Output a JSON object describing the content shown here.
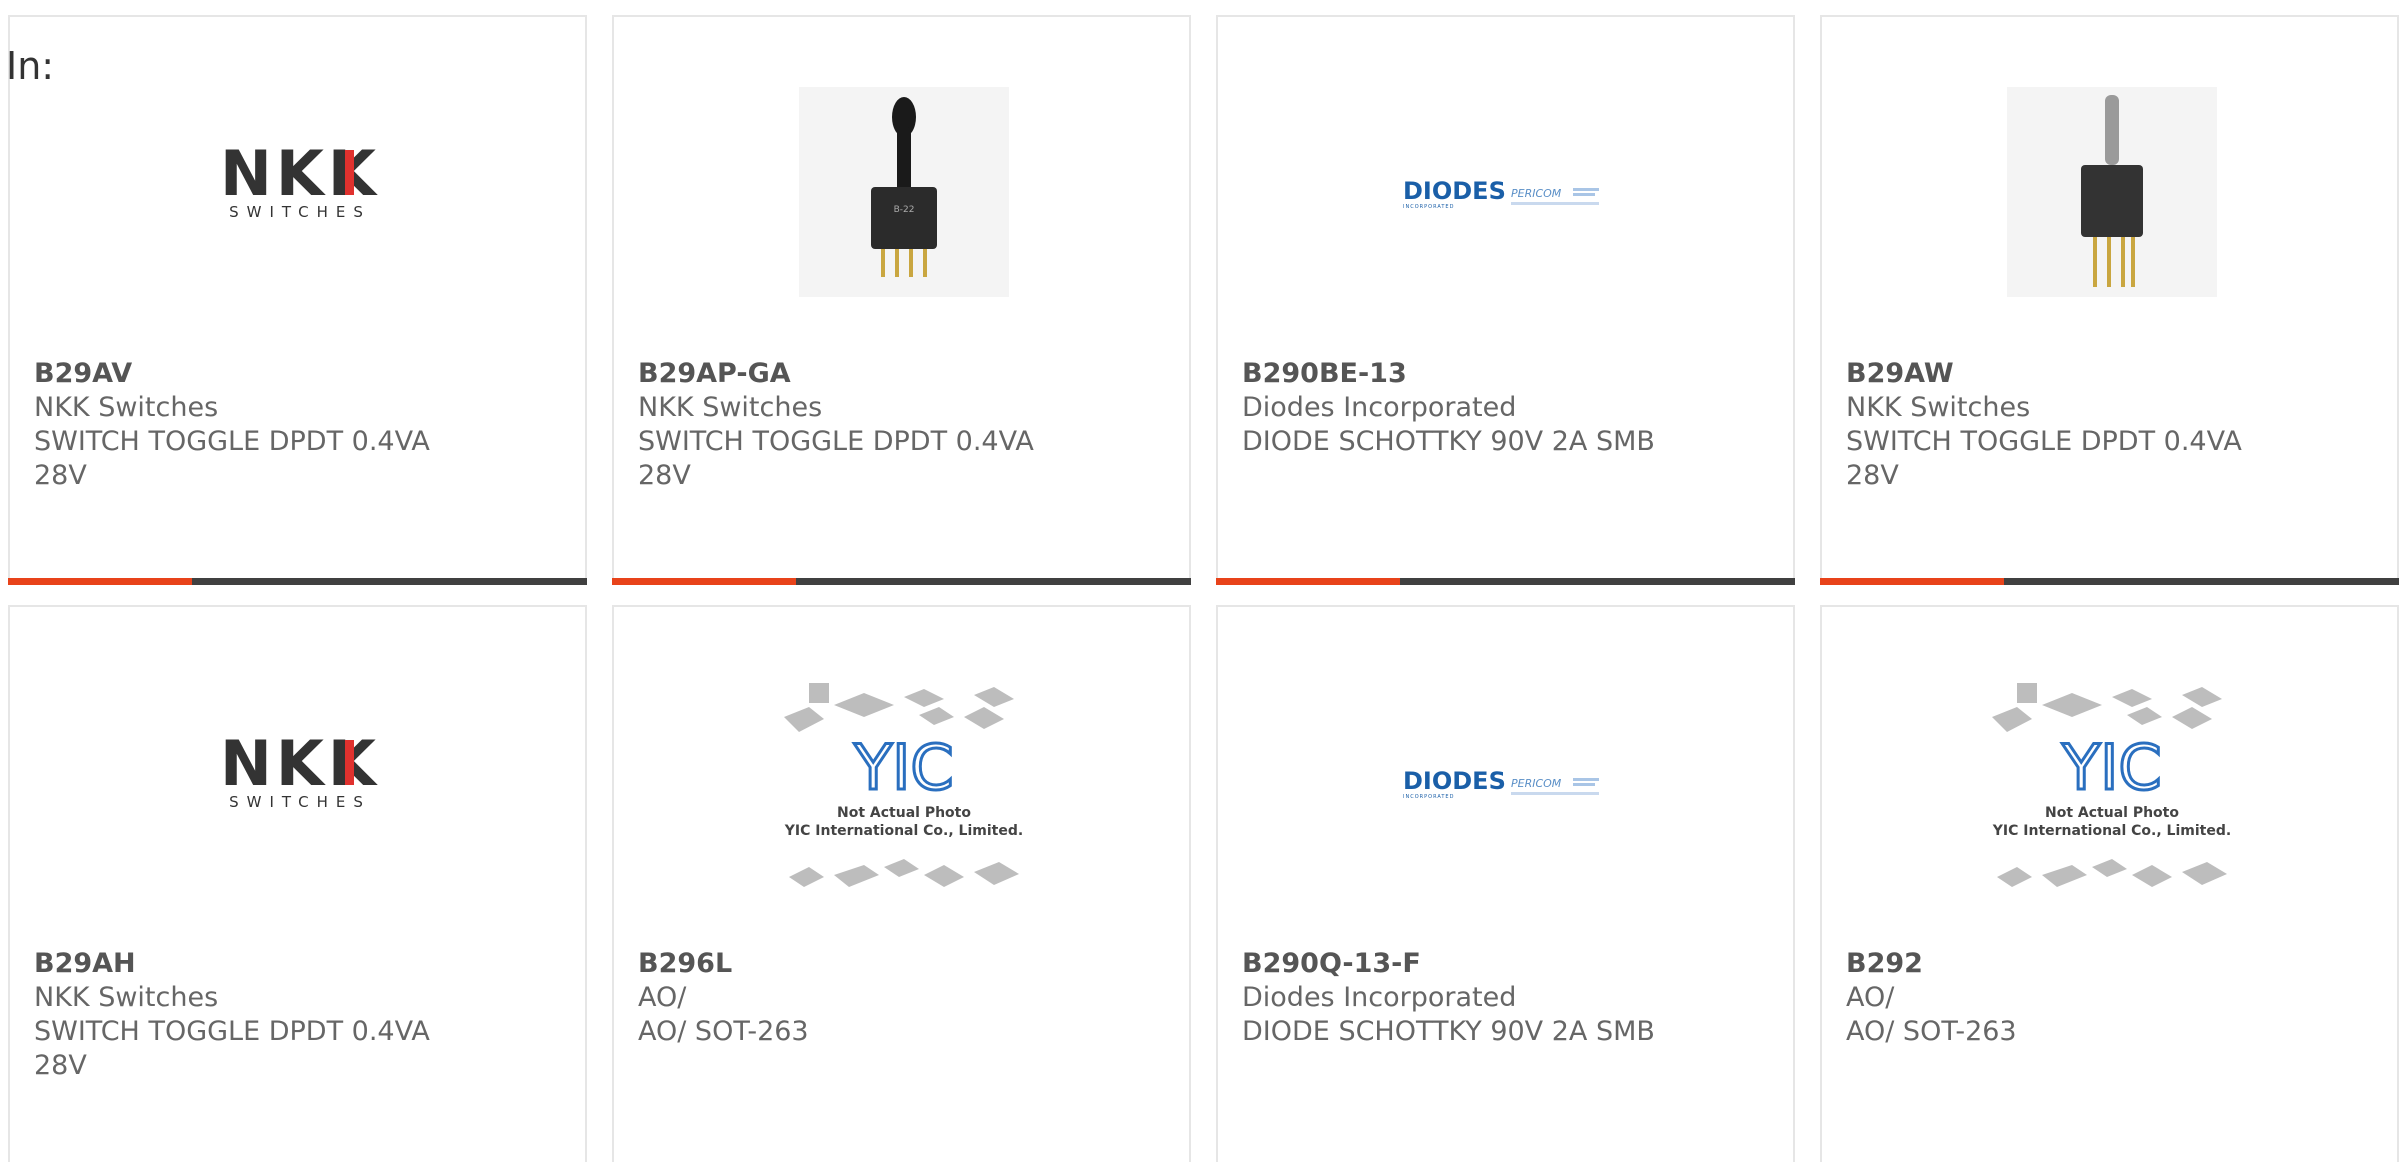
{
  "header": {
    "label": "In:"
  },
  "colors": {
    "accent": "#e8431a",
    "bar_dark": "#404040",
    "nkk_red": "#e0312e",
    "diodes_blue": "#1a5fa8"
  },
  "cards": [
    {
      "part": "B29AV",
      "manufacturer": "NKK Switches",
      "description": "SWITCH TOGGLE DPDT 0.4VA 28V",
      "image": "nkk-logo"
    },
    {
      "part": "B29AP-GA",
      "manufacturer": "NKK Switches",
      "description": "SWITCH TOGGLE DPDT 0.4VA 28V",
      "image": "toggle-switch-photo"
    },
    {
      "part": "B290BE-13",
      "manufacturer": "Diodes Incorporated",
      "description": "DIODE SCHOTTKY 90V 2A SMB",
      "image": "diodes-logo"
    },
    {
      "part": "B29AW",
      "manufacturer": "NKK Switches",
      "description": "SWITCH TOGGLE DPDT 0.4VA 28V",
      "image": "toggle-switch-photo"
    },
    {
      "part": "B29AH",
      "manufacturer": "NKK Switches",
      "description": "SWITCH TOGGLE DPDT 0.4VA 28V",
      "image": "nkk-logo"
    },
    {
      "part": "B296L",
      "manufacturer": "AO/",
      "description": "AO/ SOT-263",
      "image": "yic-placeholder"
    },
    {
      "part": "B290Q-13-F",
      "manufacturer": "Diodes Incorporated",
      "description": "DIODE SCHOTTKY 90V 2A SMB",
      "image": "diodes-logo"
    },
    {
      "part": "B292",
      "manufacturer": "AO/",
      "description": "AO/ SOT-263",
      "image": "yic-placeholder"
    }
  ],
  "logos": {
    "nkk_main": "NKK",
    "nkk_sub": "SWITCHES",
    "diodes_main": "DIODES",
    "diodes_sub": "INCORPORATED",
    "pericom": "PERICOM",
    "yic_line1": "Not Actual Photo",
    "yic_line2": "YIC International Co., Limited."
  }
}
